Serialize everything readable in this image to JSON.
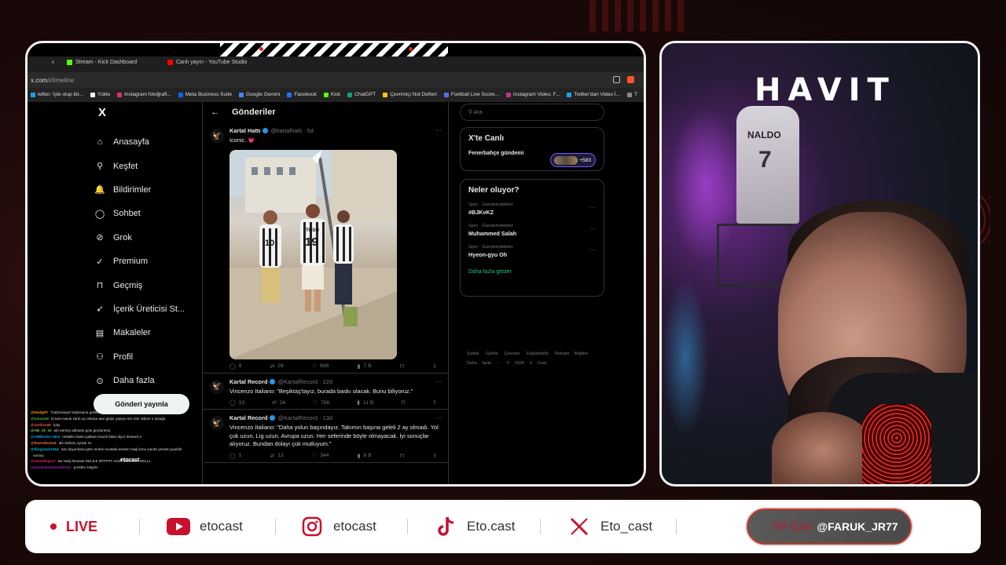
{
  "overlay_brand": "HAVIT",
  "browser": {
    "tabs": [
      {
        "label": "Stream - Kick Dashboard",
        "icon": "kick-icon"
      },
      {
        "label": "Canlı yayın - YouTube Studio",
        "icon": "youtube-icon"
      }
    ],
    "url": "x.com",
    "url_path": "/i/timeline",
    "bookmarks": [
      "witter: İşte olup bit...",
      "Yükle",
      "Instagram fotoğrafl...",
      "Meta Business Suite",
      "Google Gemini",
      "Facebook",
      "Kick",
      "ChatGPT",
      "Çevrimiçi Not Defteri",
      "Football Live Score...",
      "Instagram Video, F...",
      "Twitter'dan Video İ...",
      "T"
    ]
  },
  "x": {
    "logo": "X",
    "nav": [
      {
        "label": "Anasayfa",
        "icon": "home-icon",
        "glyph": "⌂"
      },
      {
        "label": "Keşfet",
        "icon": "search-icon",
        "glyph": "⚲"
      },
      {
        "label": "Bildirimler",
        "icon": "bell-icon",
        "glyph": "🔔"
      },
      {
        "label": "Sohbet",
        "icon": "chat-icon",
        "glyph": "◯"
      },
      {
        "label": "Grok",
        "icon": "grok-icon",
        "glyph": "⊘"
      },
      {
        "label": "Premium",
        "icon": "premium-icon",
        "glyph": "✓"
      },
      {
        "label": "Geçmiş",
        "icon": "bookmark-icon",
        "glyph": "⊓"
      },
      {
        "label": "İçerik Üreticisi St...",
        "icon": "rocket-icon",
        "glyph": "➶"
      },
      {
        "label": "Makaleler",
        "icon": "article-icon",
        "glyph": "▤"
      },
      {
        "label": "Profil",
        "icon": "profile-icon",
        "glyph": "⚇"
      },
      {
        "label": "Daha fazla",
        "icon": "more-icon",
        "glyph": "⊙"
      }
    ],
    "post_button": "Gönderi yayınla",
    "feed_title": "Gönderiler",
    "back_glyph": "←",
    "tweets": [
      {
        "name": "Kartal Hattı",
        "handle": "@kartalhatti · 5d",
        "text": "Iconic. 💗",
        "has_photo": true,
        "stats": {
          "replies": "9",
          "reposts": "28",
          "likes": "698",
          "views": "7 B"
        }
      },
      {
        "name": "Kartal Record",
        "handle": "@KartalRecord · 12d",
        "text": "Vincenzo Italiano: \"Beşiktaş'tayız, burada baskı olacak. Bunu biliyoruz.\"",
        "has_photo": false,
        "stats": {
          "replies": "13",
          "reposts": "24",
          "likes": "786",
          "views": "11 B"
        }
      },
      {
        "name": "Kartal Record",
        "handle": "@KartalRecord · 13d",
        "text": "Vincenzo Italiano: \"Daha yolun başındayız. Takımın başına geleli 2 ay olmadı. Yol çok uzun. Lig uzun, Avrupa uzun. Her seferinde böyle olmayacak. İyi sonuçlar alıyoruz. Bundan dolayı çok mutluyum.\"",
        "has_photo": false,
        "stats": {
          "replies": "1",
          "reposts": "12",
          "likes": "344",
          "views": "8 B"
        }
      }
    ],
    "photo": {
      "jersey_name": "TOSO",
      "jersey_number": "19",
      "jersey_number_2": "10"
    },
    "search_placeholder": "Ara",
    "live": {
      "title": "X'te Canlı",
      "topic": "Fenerbahçe gündemi",
      "count": "+583"
    },
    "trends": {
      "title": "Neler oluyor?",
      "items": [
        {
          "category": "Spor · Gündemdekiler",
          "topic": "#BJKvKZ"
        },
        {
          "category": "Spor · Gündemdekiler",
          "topic": "Muhammed Salah"
        },
        {
          "category": "Spor · Gündemdekiler",
          "topic": "Hyeon-gyu Oh"
        }
      ],
      "show_more": "Daha fazla göster"
    },
    "footer_links": [
      "Şartlar",
      "Gizlilik",
      "Çerezler",
      "Erişilebilirlik",
      "Reklam Bilgileri",
      "Daha fazla ···",
      "© 2026 X Corp."
    ]
  },
  "chat": [
    {
      "user": "@HodgRT",
      "msg": "Trabzonspor köylerama gelsin"
    },
    {
      "user": "@tulu4199",
      "msg": "bi tane tavuk vardı ya orkuna atar gidiyr yapıyo me sinir oldum o tavuğa"
    },
    {
      "user": "@vartiiss69",
      "msg": "Çöp"
    },
    {
      "user": "@AB_19_19",
      "msg": "abi rammy abbasin golu gorduntmu"
    },
    {
      "user": "@ABBhobo-1903",
      "msg": "neskiler balon patladı torunk falan diyor tiresard a"
    },
    {
      "user": "@thanskbo216",
      "msg": "abi olvheiç oyradı mı"
    },
    {
      "user": "@hlogomer1454",
      "msg": "son duyumlara göre mohei mustafa sersen mağ sonu içerde yemek yiyebilir"
    },
    {
      "user": "",
      "msg": "vermiş"
    },
    {
      "user": "@SametEge17",
      "msg": "Bu Harij Mousse DELİLE DFFFFF HADİ MOUSSA GELLL"
    },
    {
      "user": "@Kardeşimbenimfirmio",
      "msg": "porsbtz zatgiris"
    }
  ],
  "chat_overlay_name": "etocast",
  "bottom_bar": {
    "live_label": "LIVE",
    "youtube": "etocast",
    "instagram": "etocast",
    "tiktok": "Eto.cast",
    "x": "Eto_cast",
    "tip_prefix": "TİP İÇİN",
    "tip_handle": "@FARUK_JR77"
  },
  "colors": {
    "accent": "#c8102e",
    "verified": "#1d9bf0",
    "x_bg": "#000000",
    "live_purple": "#7856ff",
    "link_green": "#1ac97c"
  }
}
